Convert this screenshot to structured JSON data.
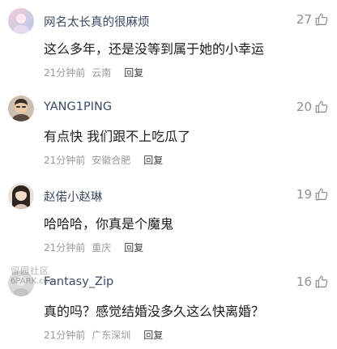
{
  "comments": [
    {
      "username": "网名太长真的很麻烦",
      "likes": "27",
      "content": "这么多年，还是没等到属于她的小幸运",
      "time": "21分钟前",
      "location": "云南",
      "reply": "回复"
    },
    {
      "username": "YANG1PING",
      "likes": "20",
      "content": "有点快 我们跟不上吃瓜了",
      "time": "21分钟前",
      "location": "安徽合肥",
      "reply": "回复"
    },
    {
      "username": "赵偌小赵琳",
      "likes": "19",
      "content": "哈哈哈，你真是个魔鬼",
      "time": "21分钟前",
      "location": "重庆",
      "reply": "回复"
    },
    {
      "username": "Fantasy_Zip",
      "likes": "16",
      "content": "真的吗？感觉结婚没多久这么快离婚？",
      "time": "21分钟前",
      "location": "广东深圳",
      "reply": "回复"
    }
  ],
  "watermark": {
    "line1": "留园社区",
    "line2": "6PARK.com"
  },
  "icons": {
    "like": "thumbs-up-icon"
  }
}
